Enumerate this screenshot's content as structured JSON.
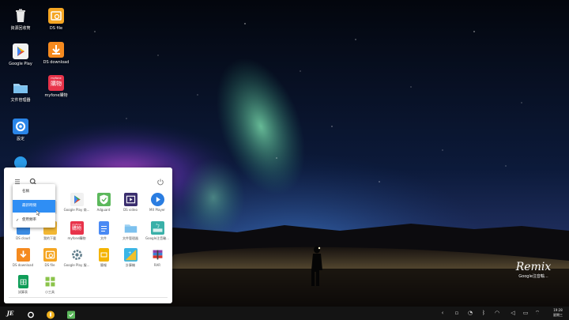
{
  "desktop": {
    "icons": [
      {
        "name": "recycle-bin",
        "label": "資源回收筒",
        "icon": "trash-icon"
      },
      {
        "name": "google-play",
        "label": "Google Play",
        "icon": "play-store-icon"
      },
      {
        "name": "file-manager",
        "label": "文件管理器",
        "icon": "folder-icon"
      },
      {
        "name": "settings",
        "label": "設定",
        "icon": "gear-icon"
      },
      {
        "name": "ds-file",
        "label": "DS file",
        "icon": "ds-file-icon"
      },
      {
        "name": "ds-download",
        "label": "DS download",
        "icon": "ds-download-icon"
      },
      {
        "name": "myfone",
        "label": "myfone購物",
        "icon": "myfone-icon",
        "badge": "myfone",
        "badge_big": "購物"
      }
    ]
  },
  "start_menu": {
    "apps": [
      {
        "label": "",
        "icon": "app-icon"
      },
      {
        "label": "",
        "icon": "app-icon"
      },
      {
        "label": "Google Play 商...",
        "icon": "play-store-icon"
      },
      {
        "label": "Adguard",
        "icon": "shield-icon"
      },
      {
        "label": "DS video",
        "icon": "video-icon"
      },
      {
        "label": "MX Player",
        "icon": "play-icon"
      },
      {
        "label": "DS cloud",
        "icon": "cloud-icon"
      },
      {
        "label": "我的下載",
        "icon": "download-icon"
      },
      {
        "label": "myfone購物",
        "icon": "myfone-icon"
      },
      {
        "label": "文件",
        "icon": "document-icon"
      },
      {
        "label": "文件管理器",
        "icon": "folder-icon"
      },
      {
        "label": "Google注音輸...",
        "icon": "keyboard-icon"
      },
      {
        "label": "DS download",
        "icon": "ds-download-icon"
      },
      {
        "label": "DS file",
        "icon": "ds-file-icon"
      },
      {
        "label": "Google Play 服...",
        "icon": "gear-icon"
      },
      {
        "label": "簡報",
        "icon": "slides-icon"
      },
      {
        "label": "計算機",
        "icon": "calculator-icon"
      },
      {
        "label": "RAR",
        "icon": "rar-icon"
      },
      {
        "label": "試算表",
        "icon": "sheets-icon"
      },
      {
        "label": "小工具",
        "icon": "widgets-icon"
      }
    ]
  },
  "sort_dropdown": {
    "items": [
      {
        "label": "名稱",
        "checked": false,
        "active": false
      },
      {
        "label": "最新時間",
        "checked": false,
        "active": true
      },
      {
        "label": "使用頻率",
        "checked": true,
        "active": false
      }
    ]
  },
  "watermark": {
    "logo": "Remix",
    "label": "Google注音輸..."
  },
  "taskbar": {
    "start_label": "JE",
    "time": "19:28",
    "date": "星期三"
  },
  "colors": {
    "accent": "#2f8ef4",
    "taskbar": "#141414"
  }
}
